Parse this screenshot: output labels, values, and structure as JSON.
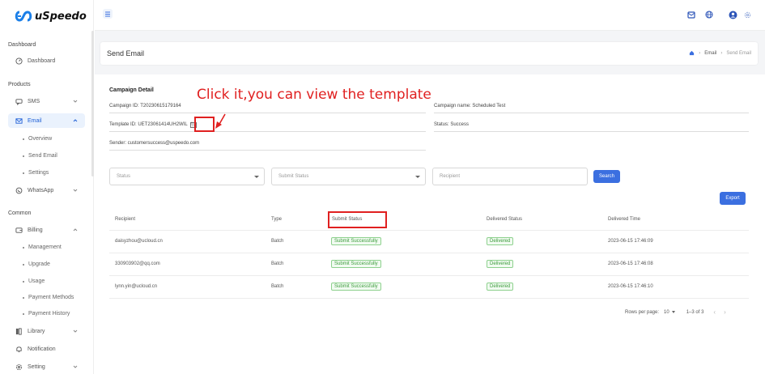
{
  "app": {
    "name": "uSpeedo"
  },
  "sidebar": {
    "sections": [
      "Dashboard",
      "Products",
      "Common"
    ],
    "items": {
      "dashboard": "Dashboard",
      "sms": "SMS",
      "email": "Email",
      "whatsapp": "WhatsApp",
      "billing": "Billing",
      "library": "Library",
      "notification": "Notification",
      "setting": "Setting"
    },
    "email_sub": [
      "Overview",
      "Send Email",
      "Settings"
    ],
    "billing_sub": [
      "Management",
      "Upgrade",
      "Usage",
      "Payment Methods",
      "Payment History"
    ]
  },
  "header": {
    "page_title": "Send Email",
    "breadcrumb": [
      "Email",
      "Send Email"
    ]
  },
  "detail": {
    "title": "Campaign Detail",
    "campaign_id": "Campaign ID: T20230615179164",
    "template_id": "Template ID: UET23061414UH2WIL",
    "sender": "Sender: customersuccess@uspeedo.com",
    "campaign_name": "Campaign name: Scheduled Test",
    "status": "Status: Success"
  },
  "annotation": {
    "text": "Click it,you can view the template"
  },
  "filters": {
    "status_placeholder": "Status",
    "submit_status_placeholder": "Submit Status",
    "recipient_placeholder": "Recipient",
    "search_label": "Search",
    "export_label": "Export"
  },
  "table": {
    "headers": [
      "Recipient",
      "Type",
      "Submit Status",
      "Delivered Status",
      "Delivered Time"
    ],
    "rows": [
      {
        "recipient": "daisyzhou@ucloud.cn",
        "type": "Batch",
        "submit": "Submit Successfully",
        "delivered": "Delivered",
        "time": "2023-06-15 17:46:09"
      },
      {
        "recipient": "330903902@qq.com",
        "type": "Batch",
        "submit": "Submit Successfully",
        "delivered": "Delivered",
        "time": "2023-06-15 17:46:08"
      },
      {
        "recipient": "lynn.yin@ucloud.cn",
        "type": "Batch",
        "submit": "Submit Successfully",
        "delivered": "Delivered",
        "time": "2023-06-15 17:46:10"
      }
    ]
  },
  "pagination": {
    "rows_label": "Rows per page:",
    "rows_value": "10",
    "range": "1–3 of 3"
  },
  "colors": {
    "accent": "#3b6fe0",
    "annotation": "#e02020",
    "success": "#3c9b3c"
  }
}
